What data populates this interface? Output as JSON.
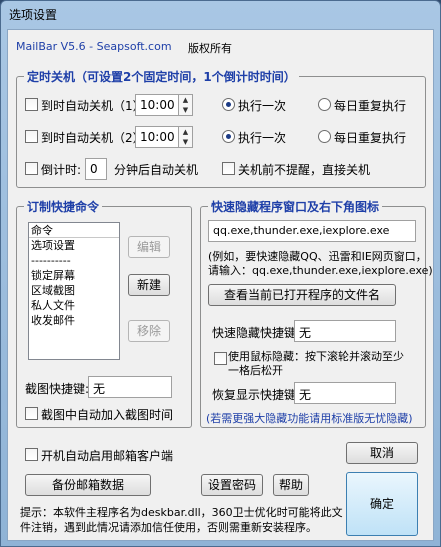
{
  "window": {
    "title": "选项设置"
  },
  "header": {
    "app": "MailBar V5.6 - Seapsoft.com",
    "copyright": "版权所有"
  },
  "shutdown": {
    "legend": "定时关机（可设置2个固定时间，1个倒计时时间）",
    "row1": {
      "label": "到时自动关机（1）",
      "time": "10:00",
      "once": "执行一次",
      "daily": "每日重复执行"
    },
    "row2": {
      "label": "到时自动关机（2）",
      "time": "10:00",
      "once": "执行一次",
      "daily": "每日重复执行"
    },
    "countdown": {
      "label": "倒计时:",
      "value": "0",
      "suffix": "分钟后自动关机",
      "no_prompt": "关机前不提醒，直接关机"
    }
  },
  "shortcut_commands": {
    "legend": "订制快捷命令",
    "list_header": "命令",
    "items": [
      "选项设置",
      "----------",
      "锁定屏幕",
      "区域截图",
      "私人文件",
      "收发邮件"
    ],
    "edit": "编辑",
    "new": "新建",
    "move": "移除"
  },
  "screenshot": {
    "hotkey_label": "截图快捷键:",
    "hotkey_value": "无",
    "add_time_label": "截图中自动加入截图时间"
  },
  "hide": {
    "legend": "快速隐藏程序窗口及右下角图标",
    "programs": "qq.exe,thunder.exe,iexplore.exe",
    "hint1": "(例如，要快速隐藏QQ、迅雷和IE网页窗口，",
    "hint2": "请输入：qq.exe,thunder.exe,iexplore.exe)",
    "view_button": "查看当前已打开程序的文件名",
    "hide_hotkey_label": "快速隐藏快捷键:",
    "hide_hotkey_value": "无",
    "mouse_label_1": "使用鼠标隐藏：按下滚轮并滚动至少",
    "mouse_label_2": "一格后松开",
    "restore_hotkey_label": "恢复显示快捷键:",
    "restore_hotkey_value": "无",
    "note": "(若需更强大隐藏功能请用标准版无忧隐藏)"
  },
  "footer": {
    "autostart": "开机自动启用邮箱客户端",
    "cancel": "取消",
    "backup": "备份邮箱数据",
    "password": "设置密码",
    "help": "帮助",
    "ok": "确定",
    "tip1": "提示：本软件主程序名为deskbar.dll，360卫士优化时可能将此文",
    "tip2": "件注销，遇到此情况请添加信任使用，否则需重新安装程序。"
  }
}
